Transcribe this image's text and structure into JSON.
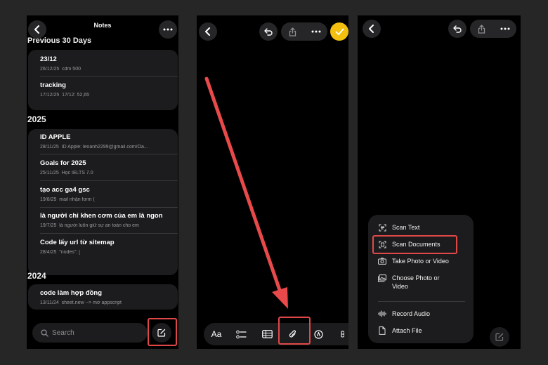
{
  "panel1": {
    "title": "Notes",
    "sections": [
      {
        "header": "Previous 30 Days",
        "notes": [
          {
            "title": "23/12",
            "date": "26/12/25",
            "preview": "cdm 500"
          },
          {
            "title": "tracking",
            "date": "17/12/25",
            "preview": "17/12: 52,65"
          }
        ]
      },
      {
        "header": "2025",
        "notes": [
          {
            "title": "ID APPLE",
            "date": "28/11/25",
            "preview": "ID Apple: leoanh2299@gmail.com/Oa..."
          },
          {
            "title": "Goals for 2025",
            "date": "25/11/25",
            "preview": "Học IELTS 7.0"
          },
          {
            "title": "tạo acc ga4 gsc",
            "date": "19/8/25",
            "preview": "mail nhận form ("
          },
          {
            "title": "là người chỉ khen cơm của em là ngon",
            "date": "19/7/25",
            "preview": "là người luôn giữ sự an toàn cho em"
          },
          {
            "title": "Code lấy url từ sitemap",
            "date": "28/4/25",
            "preview": "\"nodes\": ["
          }
        ]
      },
      {
        "header": "2024",
        "notes": [
          {
            "title": "code làm hợp đồng",
            "date": "13/11/24",
            "preview": "sheet.new --> mở appscript"
          }
        ]
      }
    ],
    "search_placeholder": "Search"
  },
  "panel2": {
    "format_label": "Aa"
  },
  "panel3": {
    "menu": [
      {
        "label": "Scan Text",
        "icon": "scan-text-icon"
      },
      {
        "label": "Scan Documents",
        "icon": "scan-documents-icon"
      },
      {
        "label": "Take Photo or Video",
        "icon": "camera-icon"
      },
      {
        "label": "Choose Photo or Video",
        "icon": "photo-library-icon"
      },
      {
        "label": "Record Audio",
        "icon": "waveform-icon"
      },
      {
        "label": "Attach File",
        "icon": "document-icon"
      }
    ]
  },
  "colors": {
    "highlight": "#e04848",
    "accent_yellow": "#f4c00f",
    "arrow": "#e8494a"
  }
}
